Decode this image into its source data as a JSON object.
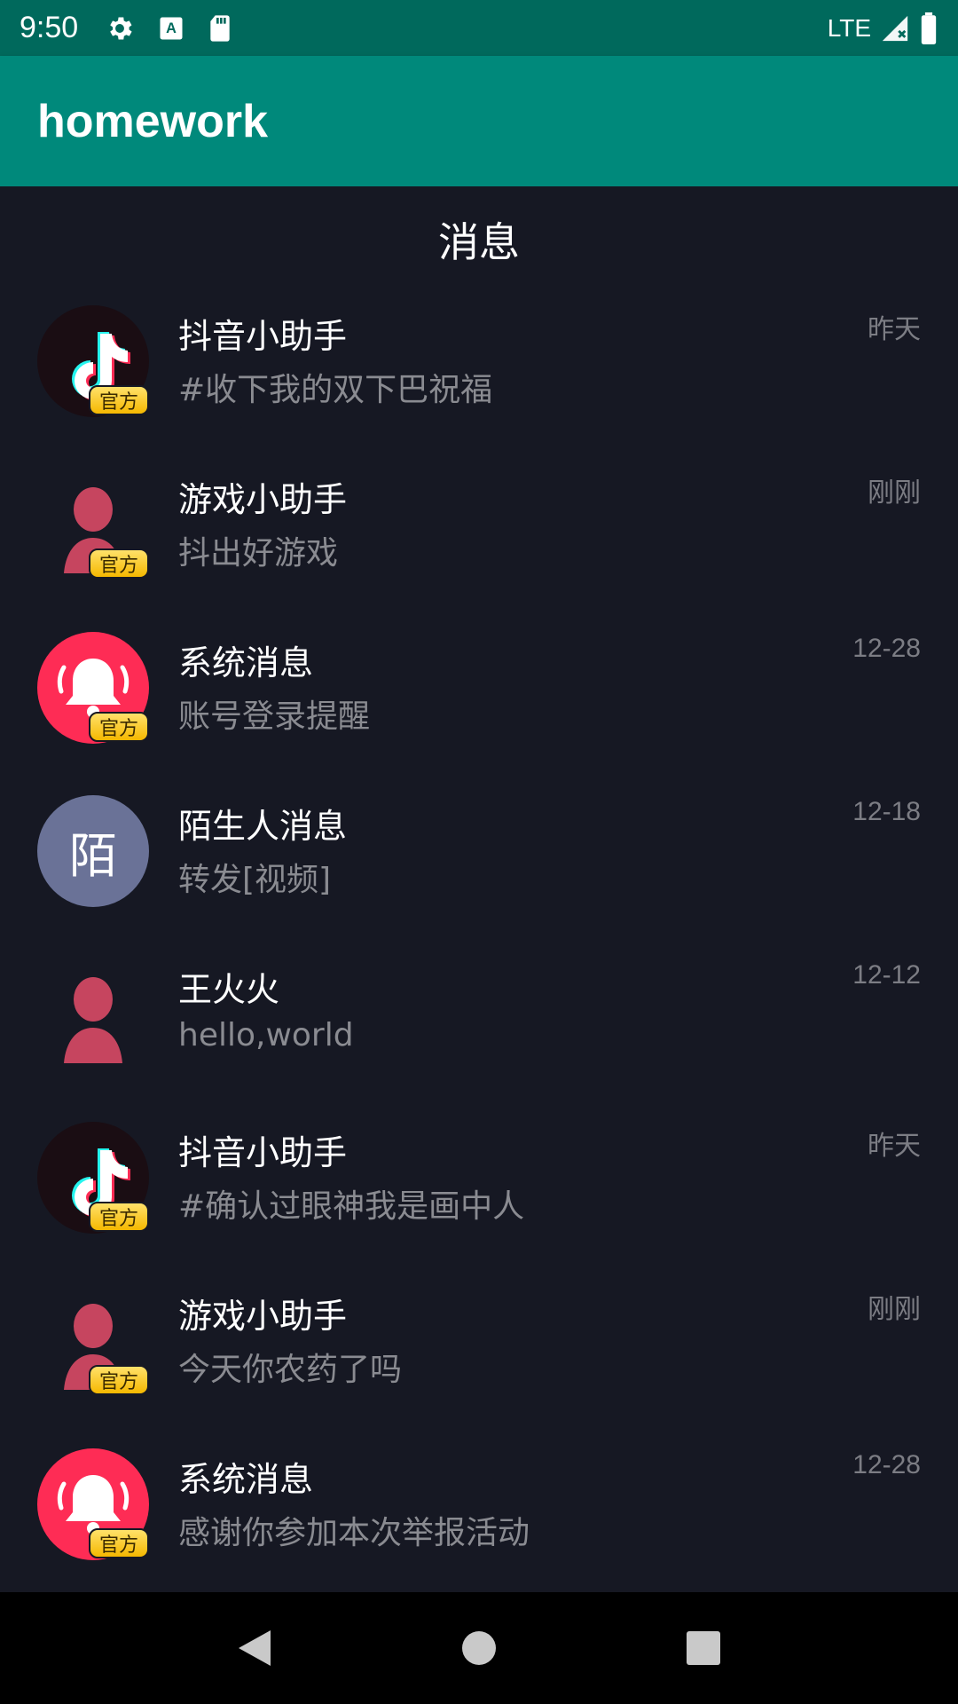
{
  "status_bar": {
    "time": "9:50",
    "network": "LTE",
    "icons": [
      "gear-icon",
      "a-box-icon",
      "sd-card-icon",
      "signal-icon",
      "battery-icon"
    ]
  },
  "app_bar": {
    "title": "homework",
    "color": "#00897b"
  },
  "page": {
    "title": "消息"
  },
  "messages": [
    {
      "avatar": "tiktok-logo",
      "badge": "官方",
      "name": "抖音小助手",
      "preview": "#收下我的双下巴祝福",
      "time": "昨天"
    },
    {
      "avatar": "person-silhouette",
      "badge": "官方",
      "name": "游戏小助手",
      "preview": "抖出好游戏",
      "time": "刚刚"
    },
    {
      "avatar": "bell",
      "badge": "官方",
      "name": "系统消息",
      "preview": "账号登录提醒",
      "time": "12-28"
    },
    {
      "avatar": "letter",
      "avatar_text": "陌",
      "name": "陌生人消息",
      "preview": "转发[视频]",
      "time": "12-18"
    },
    {
      "avatar": "person-silhouette",
      "name": "王火火",
      "preview": "hello,world",
      "time": "12-12"
    },
    {
      "avatar": "tiktok-logo",
      "badge": "官方",
      "name": "抖音小助手",
      "preview": "#确认过眼神我是画中人",
      "time": "昨天"
    },
    {
      "avatar": "person-silhouette",
      "badge": "官方",
      "name": "游戏小助手",
      "preview": "今天你农药了吗",
      "time": "刚刚"
    },
    {
      "avatar": "bell",
      "badge": "官方",
      "name": "系统消息",
      "preview": "感谢你参加本次举报活动",
      "time": "12-28"
    }
  ],
  "nav_bar": {
    "buttons": [
      "back-icon",
      "home-icon",
      "recents-icon"
    ]
  }
}
